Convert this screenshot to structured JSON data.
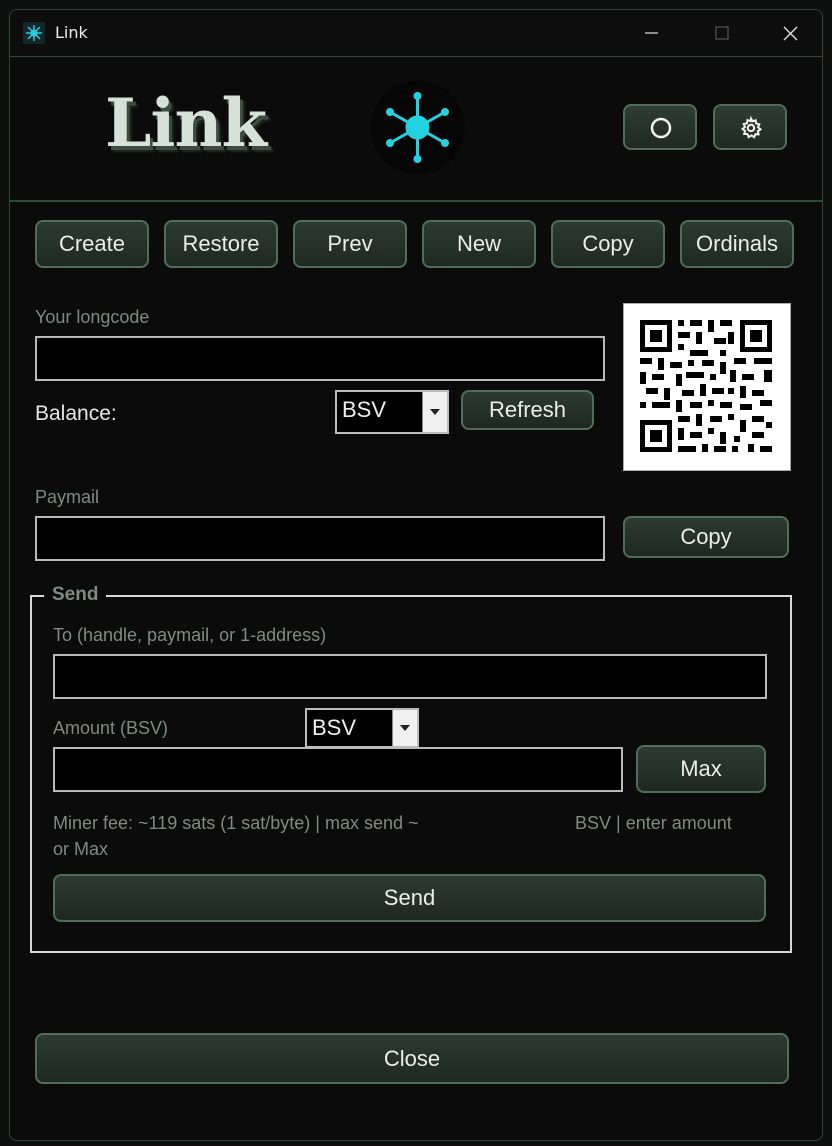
{
  "window": {
    "title": "Link"
  },
  "header": {
    "logo_text": "Link",
    "theme_icon": "circle-icon",
    "settings_icon": "gear-icon"
  },
  "toolbar": {
    "buttons": [
      "Create",
      "Restore",
      "Prev",
      "New",
      "Copy",
      "Ordinals"
    ]
  },
  "wallet": {
    "longcode_label": "Your longcode",
    "longcode_value": "",
    "balance_label": "Balance:",
    "balance_unit": "BSV",
    "refresh_label": "Refresh",
    "paymail_label": "Paymail",
    "paymail_value": "",
    "copy_label": "Copy"
  },
  "send": {
    "legend": "Send",
    "to_label": "To (handle, paymail, or 1-address)",
    "to_value": "",
    "amount_label": "Amount (BSV)",
    "amount_unit": "BSV",
    "amount_value": "",
    "max_label": "Max",
    "fee_text_1": "Miner fee: ~119 sats (1 sat/byte)  |  max send ~",
    "fee_text_2": "BSV  |  enter amount",
    "fee_text_3": "or Max",
    "send_label": "Send"
  },
  "footer": {
    "close_label": "Close"
  },
  "colors": {
    "accent": "#22d3df",
    "border": "#4f6d58",
    "background": "#0b0b0b"
  }
}
